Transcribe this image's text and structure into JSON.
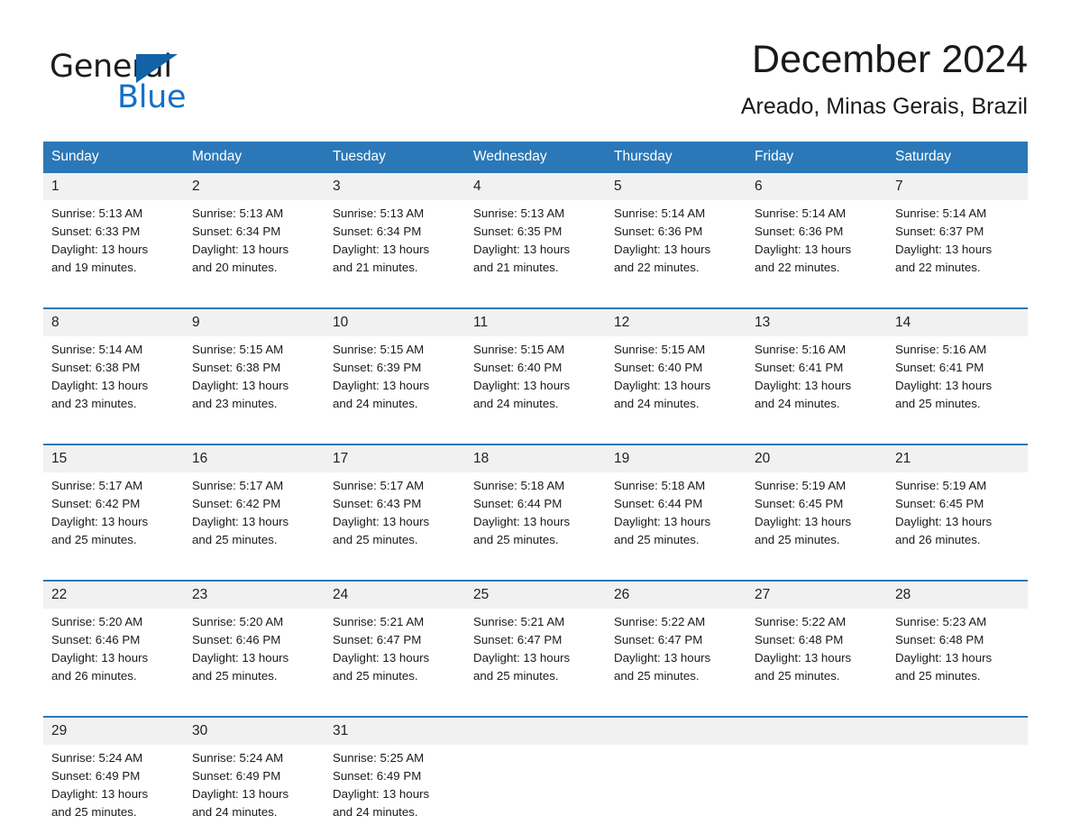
{
  "brand": {
    "name_part1": "General",
    "name_part2": "Blue",
    "triangle_color": "#1262a8",
    "blue_text_color": "#1570c4"
  },
  "header": {
    "month_title": "December 2024",
    "location": "Areado, Minas Gerais, Brazil"
  },
  "theme": {
    "header_blue": "#2a78b8",
    "rule_blue": "#2a78b8",
    "day_number_band": "#f1f1f1"
  },
  "weekday_headers": [
    "Sunday",
    "Monday",
    "Tuesday",
    "Wednesday",
    "Thursday",
    "Friday",
    "Saturday"
  ],
  "weeks": [
    {
      "days": [
        {
          "number": "1",
          "sunrise": "Sunrise: 5:13 AM",
          "sunset": "Sunset: 6:33 PM",
          "daylight_line1": "Daylight: 13 hours",
          "daylight_line2": "and 19 minutes."
        },
        {
          "number": "2",
          "sunrise": "Sunrise: 5:13 AM",
          "sunset": "Sunset: 6:34 PM",
          "daylight_line1": "Daylight: 13 hours",
          "daylight_line2": "and 20 minutes."
        },
        {
          "number": "3",
          "sunrise": "Sunrise: 5:13 AM",
          "sunset": "Sunset: 6:34 PM",
          "daylight_line1": "Daylight: 13 hours",
          "daylight_line2": "and 21 minutes."
        },
        {
          "number": "4",
          "sunrise": "Sunrise: 5:13 AM",
          "sunset": "Sunset: 6:35 PM",
          "daylight_line1": "Daylight: 13 hours",
          "daylight_line2": "and 21 minutes."
        },
        {
          "number": "5",
          "sunrise": "Sunrise: 5:14 AM",
          "sunset": "Sunset: 6:36 PM",
          "daylight_line1": "Daylight: 13 hours",
          "daylight_line2": "and 22 minutes."
        },
        {
          "number": "6",
          "sunrise": "Sunrise: 5:14 AM",
          "sunset": "Sunset: 6:36 PM",
          "daylight_line1": "Daylight: 13 hours",
          "daylight_line2": "and 22 minutes."
        },
        {
          "number": "7",
          "sunrise": "Sunrise: 5:14 AM",
          "sunset": "Sunset: 6:37 PM",
          "daylight_line1": "Daylight: 13 hours",
          "daylight_line2": "and 22 minutes."
        }
      ]
    },
    {
      "days": [
        {
          "number": "8",
          "sunrise": "Sunrise: 5:14 AM",
          "sunset": "Sunset: 6:38 PM",
          "daylight_line1": "Daylight: 13 hours",
          "daylight_line2": "and 23 minutes."
        },
        {
          "number": "9",
          "sunrise": "Sunrise: 5:15 AM",
          "sunset": "Sunset: 6:38 PM",
          "daylight_line1": "Daylight: 13 hours",
          "daylight_line2": "and 23 minutes."
        },
        {
          "number": "10",
          "sunrise": "Sunrise: 5:15 AM",
          "sunset": "Sunset: 6:39 PM",
          "daylight_line1": "Daylight: 13 hours",
          "daylight_line2": "and 24 minutes."
        },
        {
          "number": "11",
          "sunrise": "Sunrise: 5:15 AM",
          "sunset": "Sunset: 6:40 PM",
          "daylight_line1": "Daylight: 13 hours",
          "daylight_line2": "and 24 minutes."
        },
        {
          "number": "12",
          "sunrise": "Sunrise: 5:15 AM",
          "sunset": "Sunset: 6:40 PM",
          "daylight_line1": "Daylight: 13 hours",
          "daylight_line2": "and 24 minutes."
        },
        {
          "number": "13",
          "sunrise": "Sunrise: 5:16 AM",
          "sunset": "Sunset: 6:41 PM",
          "daylight_line1": "Daylight: 13 hours",
          "daylight_line2": "and 24 minutes."
        },
        {
          "number": "14",
          "sunrise": "Sunrise: 5:16 AM",
          "sunset": "Sunset: 6:41 PM",
          "daylight_line1": "Daylight: 13 hours",
          "daylight_line2": "and 25 minutes."
        }
      ]
    },
    {
      "days": [
        {
          "number": "15",
          "sunrise": "Sunrise: 5:17 AM",
          "sunset": "Sunset: 6:42 PM",
          "daylight_line1": "Daylight: 13 hours",
          "daylight_line2": "and 25 minutes."
        },
        {
          "number": "16",
          "sunrise": "Sunrise: 5:17 AM",
          "sunset": "Sunset: 6:42 PM",
          "daylight_line1": "Daylight: 13 hours",
          "daylight_line2": "and 25 minutes."
        },
        {
          "number": "17",
          "sunrise": "Sunrise: 5:17 AM",
          "sunset": "Sunset: 6:43 PM",
          "daylight_line1": "Daylight: 13 hours",
          "daylight_line2": "and 25 minutes."
        },
        {
          "number": "18",
          "sunrise": "Sunrise: 5:18 AM",
          "sunset": "Sunset: 6:44 PM",
          "daylight_line1": "Daylight: 13 hours",
          "daylight_line2": "and 25 minutes."
        },
        {
          "number": "19",
          "sunrise": "Sunrise: 5:18 AM",
          "sunset": "Sunset: 6:44 PM",
          "daylight_line1": "Daylight: 13 hours",
          "daylight_line2": "and 25 minutes."
        },
        {
          "number": "20",
          "sunrise": "Sunrise: 5:19 AM",
          "sunset": "Sunset: 6:45 PM",
          "daylight_line1": "Daylight: 13 hours",
          "daylight_line2": "and 25 minutes."
        },
        {
          "number": "21",
          "sunrise": "Sunrise: 5:19 AM",
          "sunset": "Sunset: 6:45 PM",
          "daylight_line1": "Daylight: 13 hours",
          "daylight_line2": "and 26 minutes."
        }
      ]
    },
    {
      "days": [
        {
          "number": "22",
          "sunrise": "Sunrise: 5:20 AM",
          "sunset": "Sunset: 6:46 PM",
          "daylight_line1": "Daylight: 13 hours",
          "daylight_line2": "and 26 minutes."
        },
        {
          "number": "23",
          "sunrise": "Sunrise: 5:20 AM",
          "sunset": "Sunset: 6:46 PM",
          "daylight_line1": "Daylight: 13 hours",
          "daylight_line2": "and 25 minutes."
        },
        {
          "number": "24",
          "sunrise": "Sunrise: 5:21 AM",
          "sunset": "Sunset: 6:47 PM",
          "daylight_line1": "Daylight: 13 hours",
          "daylight_line2": "and 25 minutes."
        },
        {
          "number": "25",
          "sunrise": "Sunrise: 5:21 AM",
          "sunset": "Sunset: 6:47 PM",
          "daylight_line1": "Daylight: 13 hours",
          "daylight_line2": "and 25 minutes."
        },
        {
          "number": "26",
          "sunrise": "Sunrise: 5:22 AM",
          "sunset": "Sunset: 6:47 PM",
          "daylight_line1": "Daylight: 13 hours",
          "daylight_line2": "and 25 minutes."
        },
        {
          "number": "27",
          "sunrise": "Sunrise: 5:22 AM",
          "sunset": "Sunset: 6:48 PM",
          "daylight_line1": "Daylight: 13 hours",
          "daylight_line2": "and 25 minutes."
        },
        {
          "number": "28",
          "sunrise": "Sunrise: 5:23 AM",
          "sunset": "Sunset: 6:48 PM",
          "daylight_line1": "Daylight: 13 hours",
          "daylight_line2": "and 25 minutes."
        }
      ]
    },
    {
      "days": [
        {
          "number": "29",
          "sunrise": "Sunrise: 5:24 AM",
          "sunset": "Sunset: 6:49 PM",
          "daylight_line1": "Daylight: 13 hours",
          "daylight_line2": "and 25 minutes."
        },
        {
          "number": "30",
          "sunrise": "Sunrise: 5:24 AM",
          "sunset": "Sunset: 6:49 PM",
          "daylight_line1": "Daylight: 13 hours",
          "daylight_line2": "and 24 minutes."
        },
        {
          "number": "31",
          "sunrise": "Sunrise: 5:25 AM",
          "sunset": "Sunset: 6:49 PM",
          "daylight_line1": "Daylight: 13 hours",
          "daylight_line2": "and 24 minutes."
        },
        {
          "number": "",
          "sunrise": "",
          "sunset": "",
          "daylight_line1": "",
          "daylight_line2": ""
        },
        {
          "number": "",
          "sunrise": "",
          "sunset": "",
          "daylight_line1": "",
          "daylight_line2": ""
        },
        {
          "number": "",
          "sunrise": "",
          "sunset": "",
          "daylight_line1": "",
          "daylight_line2": ""
        },
        {
          "number": "",
          "sunrise": "",
          "sunset": "",
          "daylight_line1": "",
          "daylight_line2": ""
        }
      ]
    }
  ]
}
